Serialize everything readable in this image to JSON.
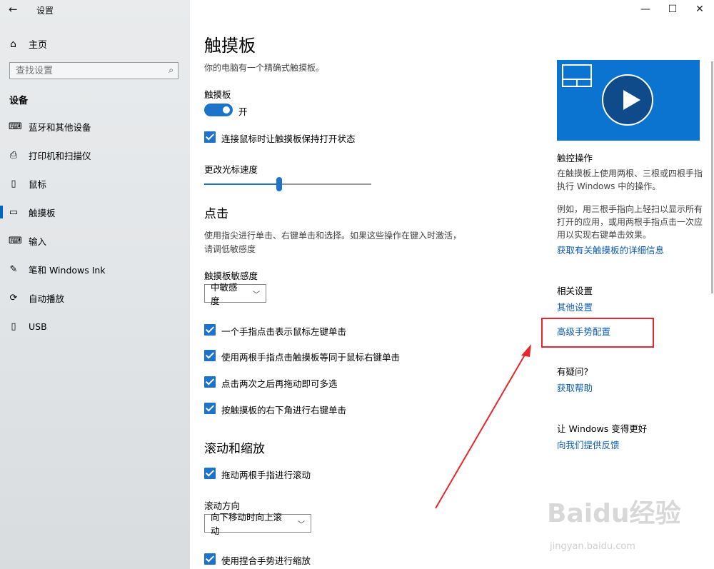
{
  "window": {
    "title": "设置",
    "back": "←",
    "minimize": "—",
    "maximize": "☐",
    "close": "✕"
  },
  "sidebar": {
    "home": "主页",
    "search_placeholder": "查找设置",
    "section": "设备",
    "items": [
      {
        "label": "蓝牙和其他设备",
        "icon": "devices-icon",
        "glyph": "⌨"
      },
      {
        "label": "打印机和扫描仪",
        "icon": "printer-icon",
        "glyph": "⎙"
      },
      {
        "label": "鼠标",
        "icon": "mouse-icon",
        "glyph": "▯"
      },
      {
        "label": "触摸板",
        "icon": "touchpad-icon",
        "glyph": "▭"
      },
      {
        "label": "输入",
        "icon": "keyboard-icon",
        "glyph": "⌨"
      },
      {
        "label": "笔和 Windows Ink",
        "icon": "pen-icon",
        "glyph": "✎"
      },
      {
        "label": "自动播放",
        "icon": "autoplay-icon",
        "glyph": "⟳"
      },
      {
        "label": "USB",
        "icon": "usb-icon",
        "glyph": "▯"
      }
    ],
    "active_index": 3
  },
  "main": {
    "title": "触摸板",
    "subtitle": "你的电脑有一个精确式触摸板。",
    "touchpad_label": "触摸板",
    "toggle_state": "开",
    "keep_on_with_mouse": "连接鼠标时让触摸板保持打开状态",
    "cursor_speed_label": "更改光标速度",
    "cursor_speed_fraction": 0.45,
    "taps_heading": "点击",
    "taps_desc": "使用指尖进行单击、右键单击和选择。如果这些操作在键入时激活，请调低敏感度",
    "sensitivity_label": "触摸板敏感度",
    "sensitivity_value": "中敏感度",
    "tap_options": [
      "一个手指点击表示鼠标左键单击",
      "使用两根手指点击触摸板等同于鼠标右键单击",
      "点击两次之后再拖动即可多选",
      "按触摸板的右下角进行右键单击"
    ],
    "scroll_heading": "滚动和缩放",
    "scroll_option": "拖动两根手指进行滚动",
    "scroll_dir_label": "滚动方向",
    "scroll_dir_value": "向下移动时向上滚动",
    "pinch_option": "使用捏合手势进行缩放"
  },
  "right": {
    "video_title": "触控操作",
    "video_desc1": "在触摸板上使用两根、三根或四根手指执行 Windows 中的操作。",
    "video_desc2": "例如，用三根手指向上轻扫以显示所有打开的应用，或用两根手指点击一次应用以实现右键单击效果。",
    "more_info_link": "获取有关触摸板的详细信息",
    "related_heading": "相关设置",
    "other_settings_link": "其他设置",
    "advanced_gesture_link": "高级手势配置",
    "question_heading": "有疑问?",
    "help_link": "获取帮助",
    "improve_heading": "让 Windows 变得更好",
    "feedback_link": "向我们提供反馈"
  },
  "watermark": {
    "logo": "Baidu经验",
    "url": "jingyan.baidu.com"
  },
  "colors": {
    "accent": "#1d73c9",
    "link": "#0a5bb5",
    "highlight": "#e8262d"
  }
}
